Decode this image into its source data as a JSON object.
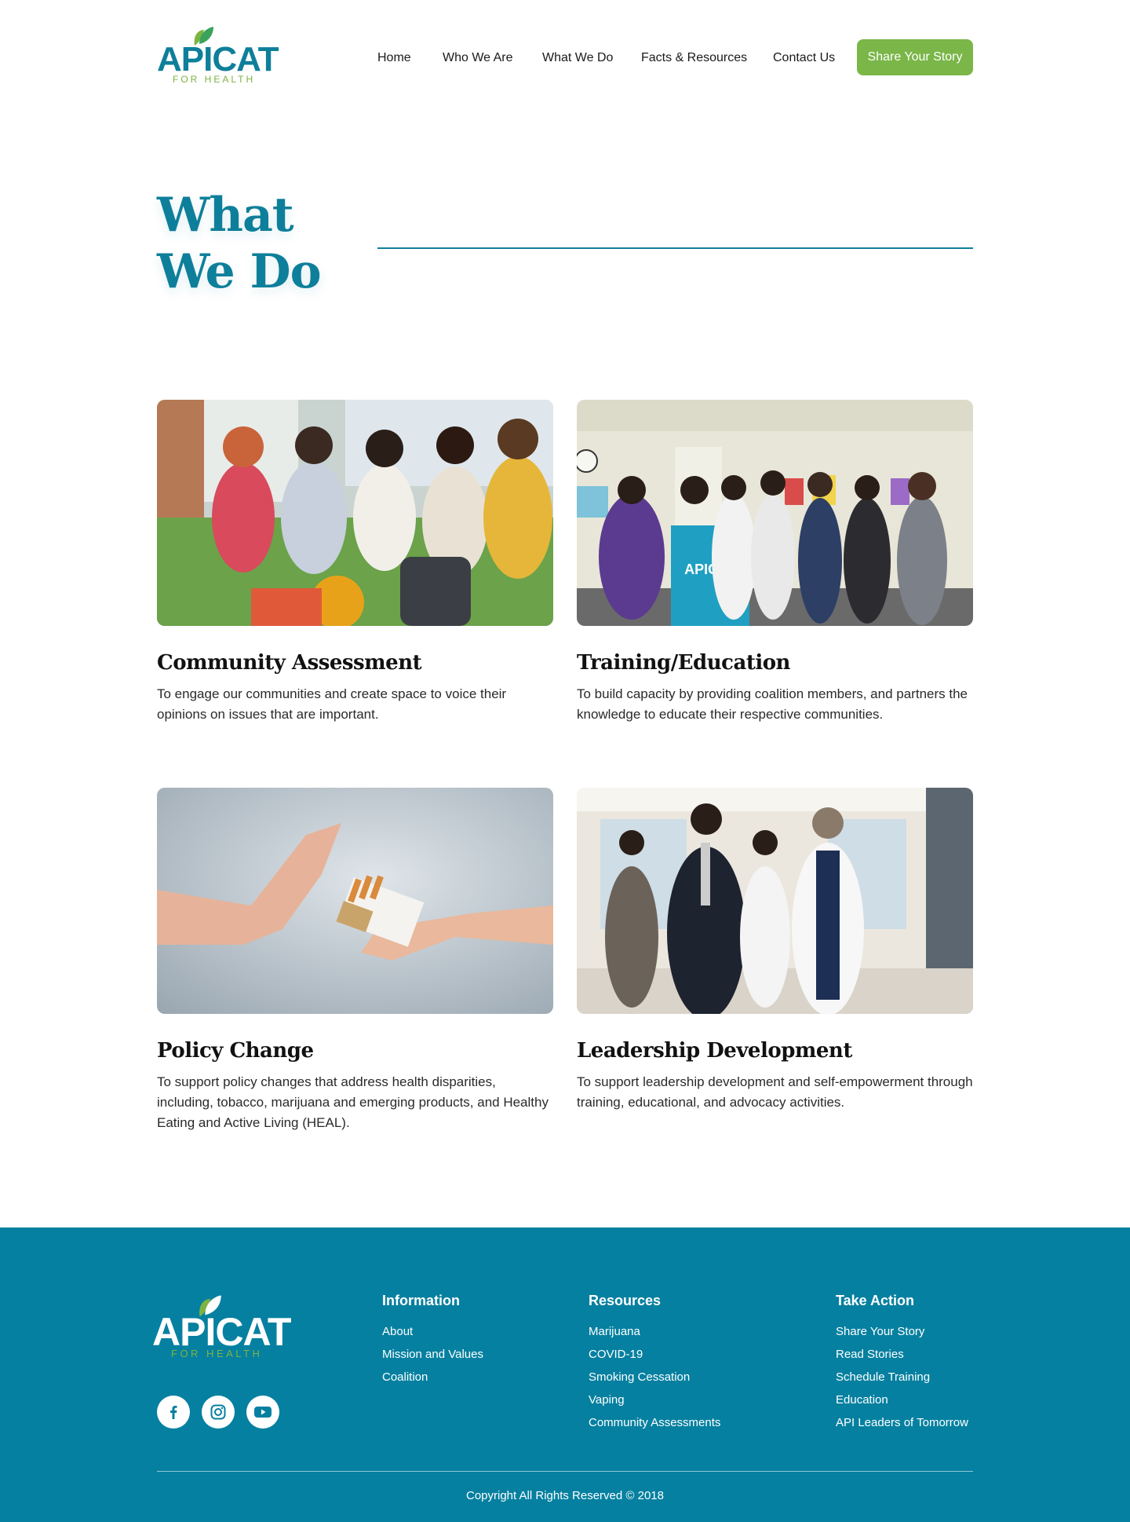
{
  "brand": {
    "name": "APICAT",
    "tagline": "FOR HEALTH",
    "primary_color": "#0e7f9a",
    "accent_color": "#7ab648",
    "footer_color": "#0680a0"
  },
  "nav": {
    "items": [
      {
        "label": "Home"
      },
      {
        "label": "Who We Are"
      },
      {
        "label": "What We Do"
      },
      {
        "label": "Facts & Resources"
      },
      {
        "label": "Contact Us"
      }
    ],
    "cta_label": "Share Your Story"
  },
  "hero": {
    "title_line1": "What",
    "title_line2": "We Do"
  },
  "cards": [
    {
      "title": "Community Assessment",
      "description": "To engage our communities and create space to voice their opinions on issues that are important.",
      "image": "students-sitting-on-grass-photo"
    },
    {
      "title": "Training/Education",
      "description": "To build capacity by providing coalition members, and partners the knowledge to educate their respective communities.",
      "image": "youth-group-holding-apicat-shirt-photo"
    },
    {
      "title": "Policy Change",
      "description": "To support policy changes that address health disparities, including, tobacco, marijuana and emerging products, and Healthy Eating and Active Living (HEAL).",
      "image": "hand-refusing-cigarettes-photo"
    },
    {
      "title": "Leadership Development",
      "description": "To support leadership development and self-empowerment through training, educational, and advocacy activities.",
      "image": "doctors-walking-in-hallway-photo"
    }
  ],
  "footer": {
    "columns": [
      {
        "heading": "Information",
        "links": [
          "About",
          "Mission and Values",
          "Coalition"
        ]
      },
      {
        "heading": "Resources",
        "links": [
          "Marijuana",
          "COVID-19",
          "Smoking Cessation",
          "Vaping",
          "Community Assessments"
        ]
      },
      {
        "heading": "Take Action",
        "links": [
          "Share Your Story",
          "Read Stories",
          "Schedule Training",
          "Education",
          "API Leaders of Tomorrow"
        ]
      }
    ],
    "social": [
      "facebook-icon",
      "instagram-icon",
      "youtube-icon"
    ],
    "copyright": "Copyright All Rights Reserved © 2018"
  }
}
